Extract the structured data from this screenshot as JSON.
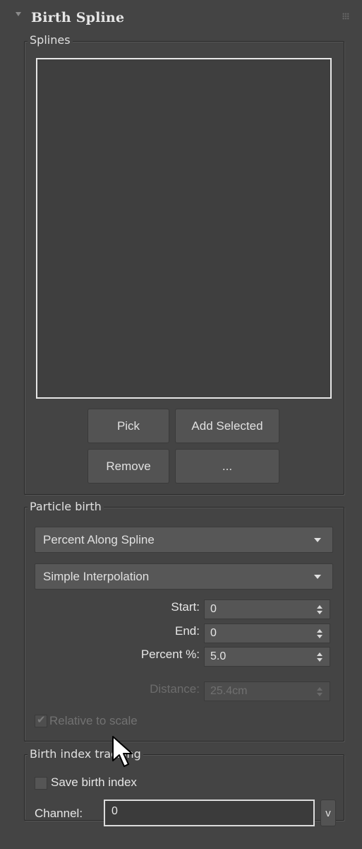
{
  "rollout": {
    "title": "Birth Spline"
  },
  "splines_group": {
    "label": "Splines",
    "buttons": {
      "pick": "Pick",
      "add_selected": "Add Selected",
      "remove": "Remove",
      "more": "..."
    }
  },
  "particle_birth": {
    "label": "Particle birth",
    "mode_dropdown": "Percent Along Spline",
    "interp_dropdown": "Simple Interpolation",
    "start_label": "Start:",
    "start_value": "0",
    "end_label": "End:",
    "end_value": "0",
    "percent_label": "Percent %:",
    "percent_value": "5.0",
    "distance_label": "Distance:",
    "distance_value": "25.4cm",
    "relative_label": "Relative to scale",
    "relative_checked": true
  },
  "birth_index": {
    "label": "Birth index tracking",
    "save_label": "Save birth index",
    "save_checked": false,
    "channel_label": "Channel:",
    "channel_value": "0",
    "channel_button": "v"
  },
  "colors": {
    "panel_bg": "#444444",
    "list_bg": "#3f3f3f",
    "button_bg": "#535353",
    "text": "#e0e0e0",
    "disabled_text": "#6c6c6c"
  },
  "icons": [
    "collapse-arrow-icon",
    "grip-icon",
    "dropdown-arrow-icon",
    "spinner-arrows-icon",
    "checkmark-icon",
    "mouse-cursor-icon"
  ]
}
